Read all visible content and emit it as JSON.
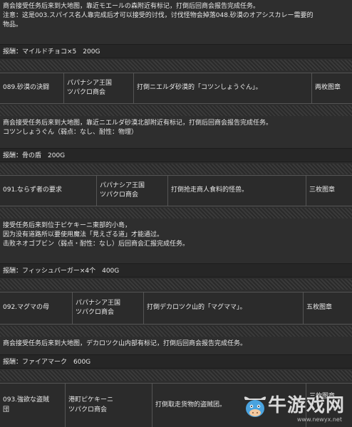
{
  "block1": {
    "desc": [
      "商会接受任务后来到大地图，靠近モエールの森附近有标记，打倒后回商会报告完成任务。",
      "注意：这是003.スパイス名人靠完成后才可以接受的讨伐，讨伐怪物会掉落048.砂漠のオアシスカレー需要的",
      "物品。"
    ],
    "reward": "报酬：マイルドチョコ×5　200G"
  },
  "quest089": {
    "name": "089.砂漠の決闘",
    "client": [
      "パパナシア王国",
      "ツパクロ商会"
    ],
    "content": "打倒ニエルダ砂漠的「コツンしょうぐん」。",
    "medals": "两枚图章"
  },
  "block2": {
    "desc": [
      "商会接受任务后来到大地图，靠近ニエルダ砂漠北部附近有标记，打倒后回商会报告完成任务。",
      "コツンしょうぐん（弱点：なし、耐性：物理）"
    ],
    "reward": "报酬：骨の盾　200G"
  },
  "quest091": {
    "name": "091.ならず者の要求",
    "client": [
      "パパナシア王国",
      "ツパクロ商会"
    ],
    "content": "打倒抢走商人食料的怪兽。",
    "medals": "三枚图章"
  },
  "block3": {
    "desc": [
      "接受任务后来到位于ピケキーニ東部的小島，",
      "因为没有道路所以要使用魔法「見えざる道」才能通过。",
      "击败ネオゴブビン（弱点・耐性：なし）后回商会汇报完成任务。"
    ],
    "reward": "报酬：フィッシュバーガー×4个　400G"
  },
  "quest092": {
    "name": "092.マグマの母",
    "client": [
      "パパナシア王国",
      "ツパクロ商会"
    ],
    "content": "打倒デカロツク山的「マグママ」。",
    "medals": "五枚图章"
  },
  "block4": {
    "desc": [
      "商会接受任务后来到大地图，デカロツク山内部有标记，打倒后回商会报告完成任务。"
    ],
    "reward": "报酬：ファイアマーク　600G"
  },
  "quest093": {
    "name": [
      "093.強欲な盗賊",
      "団"
    ],
    "client": [
      "港町ピケキーニ",
      "ツパクロ商会"
    ],
    "content": "打倒取走货物的盗贼团。",
    "medals": "三枚图章"
  },
  "watermark": {
    "brand": "牛游戏网",
    "url": "www.newyx.net"
  },
  "colors": {
    "background": "#2e2e2e",
    "text": "#e8e8e8",
    "border": "#555555"
  }
}
